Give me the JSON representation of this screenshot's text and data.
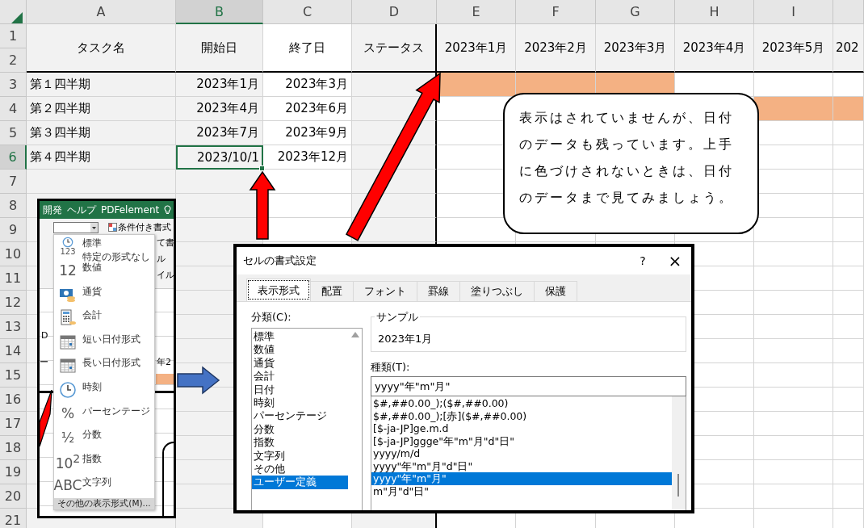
{
  "sheet": {
    "columns": [
      {
        "label": "A",
        "selected": false
      },
      {
        "label": "B",
        "selected": true
      },
      {
        "label": "C",
        "selected": false
      },
      {
        "label": "D",
        "selected": false
      },
      {
        "label": "E",
        "selected": false
      },
      {
        "label": "F",
        "selected": false
      },
      {
        "label": "G",
        "selected": false
      },
      {
        "label": "H",
        "selected": false
      },
      {
        "label": "I",
        "selected": false
      }
    ],
    "row_numbers": [
      {
        "label": "1",
        "selected": false
      },
      {
        "label": "2",
        "selected": false
      },
      {
        "label": "3",
        "selected": false
      },
      {
        "label": "4",
        "selected": false
      },
      {
        "label": "5",
        "selected": false
      },
      {
        "label": "6",
        "selected": true
      },
      {
        "label": "7",
        "selected": false
      },
      {
        "label": "8",
        "selected": false
      },
      {
        "label": "9",
        "selected": false
      },
      {
        "label": "10",
        "selected": false
      },
      {
        "label": "11",
        "selected": false
      },
      {
        "label": "12",
        "selected": false
      },
      {
        "label": "13",
        "selected": false
      },
      {
        "label": "14",
        "selected": false
      },
      {
        "label": "15",
        "selected": false
      },
      {
        "label": "16",
        "selected": false
      },
      {
        "label": "17",
        "selected": false
      },
      {
        "label": "18",
        "selected": false
      },
      {
        "label": "19",
        "selected": false
      },
      {
        "label": "20",
        "selected": false
      },
      {
        "label": "21",
        "selected": false
      }
    ],
    "header_cells": [
      "タスク名",
      "開始日",
      "終了日",
      "ステータス",
      "2023年1月",
      "2023年2月",
      "2023年3月",
      "2023年4月",
      "2023年5月",
      "202"
    ],
    "tasks": [
      {
        "name": "第１四半期",
        "start": "2023年1月",
        "end": "2023年3月",
        "selected": false,
        "gantt": [
          true,
          true,
          true,
          false,
          false,
          false
        ]
      },
      {
        "name": "第２四半期",
        "start": "2023年4月",
        "end": "2023年6月",
        "selected": false,
        "gantt": [
          false,
          true,
          true
        ]
      },
      {
        "name": "第３四半期",
        "start": "2023年7月",
        "end": "2023年9月",
        "selected": false,
        "gantt": [
          false,
          false,
          false
        ]
      },
      {
        "name": "第４四半期",
        "start": "2023/10/1",
        "end": "2023年12月",
        "selected": true,
        "gantt": [
          false,
          false,
          false
        ]
      }
    ]
  },
  "inset": {
    "tabs": [
      "開発",
      "ヘルプ",
      "PDFelement"
    ],
    "ribbon_button": "条件付き書式",
    "ribbon_fragments": [
      "て書",
      "ル",
      "イル"
    ],
    "sheet_fragments": [
      "D",
      "ー",
      "年2"
    ],
    "menu": [
      {
        "label": "標準",
        "sub": "特定の形式なし",
        "kind": "clocknumber",
        "glyph": "123"
      },
      {
        "label": "数値",
        "kind": "glyph",
        "glyph": "12"
      },
      {
        "label": "通貨",
        "kind": "money"
      },
      {
        "label": "会計",
        "kind": "calculator"
      },
      {
        "label": "短い日付形式",
        "kind": "calendar"
      },
      {
        "label": "長い日付形式",
        "kind": "calendar"
      },
      {
        "label": "時刻",
        "kind": "clock"
      },
      {
        "label": "パーセンテージ",
        "kind": "glyph",
        "glyph": "%"
      },
      {
        "label": "分数",
        "kind": "glyph",
        "glyph": "½"
      },
      {
        "label": "指数",
        "kind": "glyph",
        "glyph": "10$^{2}$"
      },
      {
        "label": "文字列",
        "kind": "glyph",
        "glyph": "ABC"
      }
    ],
    "more": "その他の表示形式(M)..."
  },
  "dialog": {
    "title": "セルの書式設定",
    "help": "?",
    "close": "×",
    "tabs": [
      {
        "label": "表示形式",
        "selected": true
      },
      {
        "label": "配置",
        "selected": false
      },
      {
        "label": "フォント",
        "selected": false
      },
      {
        "label": "罫線",
        "selected": false
      },
      {
        "label": "塗りつぶし",
        "selected": false
      },
      {
        "label": "保護",
        "selected": false
      }
    ],
    "category_label": "分類(C):",
    "categories": [
      {
        "label": "標準",
        "selected": false
      },
      {
        "label": "数値",
        "selected": false
      },
      {
        "label": "通貨",
        "selected": false
      },
      {
        "label": "会計",
        "selected": false
      },
      {
        "label": "日付",
        "selected": false
      },
      {
        "label": "時刻",
        "selected": false
      },
      {
        "label": "パーセンテージ",
        "selected": false
      },
      {
        "label": "分数",
        "selected": false
      },
      {
        "label": "指数",
        "selected": false
      },
      {
        "label": "文字列",
        "selected": false
      },
      {
        "label": "その他",
        "selected": false
      },
      {
        "label": "ユーザー定義",
        "selected": true
      }
    ],
    "sample_label": "サンプル",
    "sample": "2023年1月",
    "type_label": "種類(T):",
    "type_value": "yyyy\"年\"m\"月\"",
    "formats": [
      {
        "label": "$#,##0.00_);($#,##0.00)",
        "selected": false
      },
      {
        "label": "$#,##0.00_);[赤]($#,##0.00)",
        "selected": false
      },
      {
        "label": "[$-ja-JP]ge.m.d",
        "selected": false
      },
      {
        "label": "[$-ja-JP]ggge\"年\"m\"月\"d\"日\"",
        "selected": false
      },
      {
        "label": "yyyy/m/d",
        "selected": false
      },
      {
        "label": "yyyy\"年\"m\"月\"d\"日\"",
        "selected": false
      },
      {
        "label": "yyyy\"年\"m\"月\"",
        "selected": true
      },
      {
        "label": "m\"月\"d\"日\"",
        "selected": false
      }
    ]
  },
  "callout": {
    "text": "表示はされていませんが、日付のデータも残っています。上手に色づけされないときは、日付のデータまで見てみましょう。"
  }
}
